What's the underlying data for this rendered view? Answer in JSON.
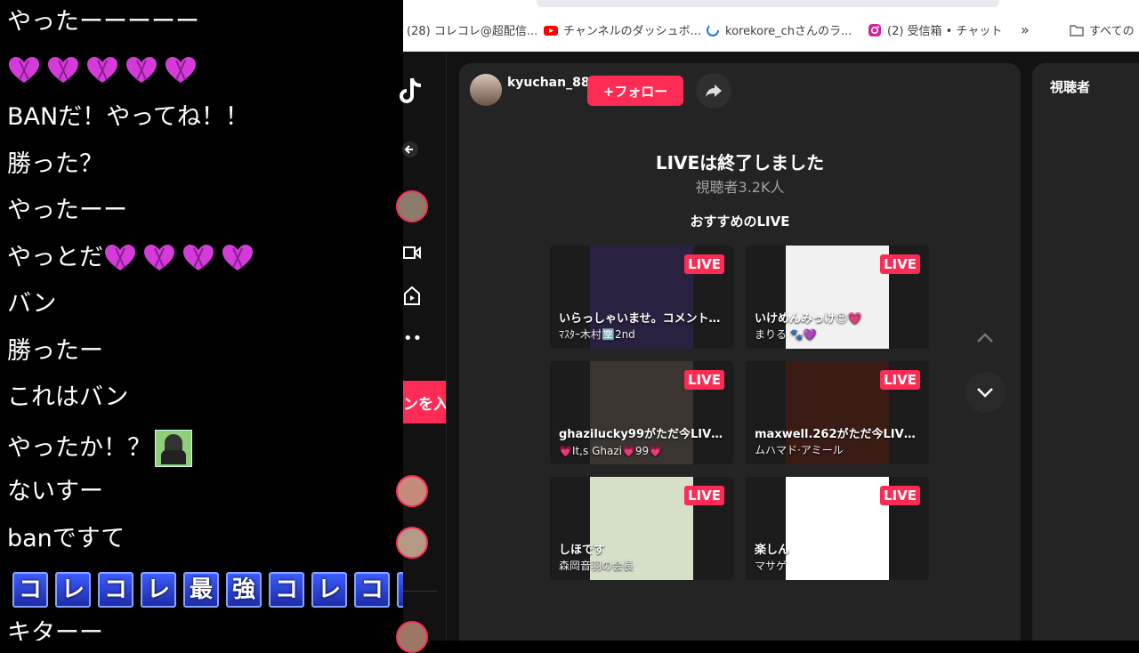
{
  "chat": {
    "messages": [
      {
        "text": "やったーーーーー"
      },
      {
        "text": ""
      },
      {
        "text": "BANだ！やってね！！"
      },
      {
        "text": "勝った？"
      },
      {
        "text": "やったーー"
      },
      {
        "text": "やっとだ"
      },
      {
        "text": "バン"
      },
      {
        "text": "勝ったー"
      },
      {
        "text": "これはバン"
      },
      {
        "text": "やったか！？"
      },
      {
        "text": "ないすー"
      },
      {
        "text": "banですて"
      },
      {
        "text": ""
      },
      {
        "text": "キターー"
      }
    ],
    "banner_chars": [
      "コ",
      "レ",
      "コ",
      "レ",
      "最",
      "強",
      "コ",
      "レ",
      "コ",
      "レ"
    ]
  },
  "bookmarks": [
    {
      "label": "(28) コレコレ@超配信...",
      "icon": "generic-page-icon"
    },
    {
      "label": "チャンネルのダッシュボ...",
      "icon": "youtube-icon"
    },
    {
      "label": "korekore_chさんのラ...",
      "icon": "loading-icon"
    },
    {
      "label": "(2) 受信箱 • チャット",
      "icon": "instagram-icon"
    },
    {
      "label": "»",
      "icon": "overflow-icon"
    },
    {
      "label": "すべての",
      "icon": "folder-icon"
    }
  ],
  "sidebar": {
    "cta_label": "ンを入"
  },
  "stream": {
    "host_name": "kyuchan_88",
    "follow_label": "+フォロー",
    "ended_title": "LIVEは終了しました",
    "viewers_line": "視聴者3.2K人",
    "recommended_title": "おすすめのLIVE",
    "live_badge": "LIVE",
    "cards": [
      {
        "title": "いらっしゃいませ。コメント、ハート...",
        "subtitle": "ﾏｽﾀｰ木村🈳2nd",
        "color": "#2a2140"
      },
      {
        "title": "いけめんみっけ😍💗",
        "subtitle": "まりる 🐾💜",
        "color": "#f1f1f1"
      },
      {
        "title": "ghazilucky99がただ今LIVE中",
        "subtitle": "💗It,s Ghazi💗99💗",
        "color": "#3a3530"
      },
      {
        "title": "maxwell.262がただ今LIVE中",
        "subtitle": "ムハマド·アミール",
        "color": "#3a1c14"
      },
      {
        "title": "しほです",
        "subtitle": "森岡音羽の会長",
        "color": "#d6e0c9"
      },
      {
        "title": "楽しん",
        "subtitle": "マサゲ",
        "color": "#ffffff"
      }
    ]
  },
  "viewer_panel": {
    "title": "視聴者"
  },
  "colors": {
    "accent": "#fe2c55",
    "panel": "#242424",
    "background": "#121212"
  }
}
